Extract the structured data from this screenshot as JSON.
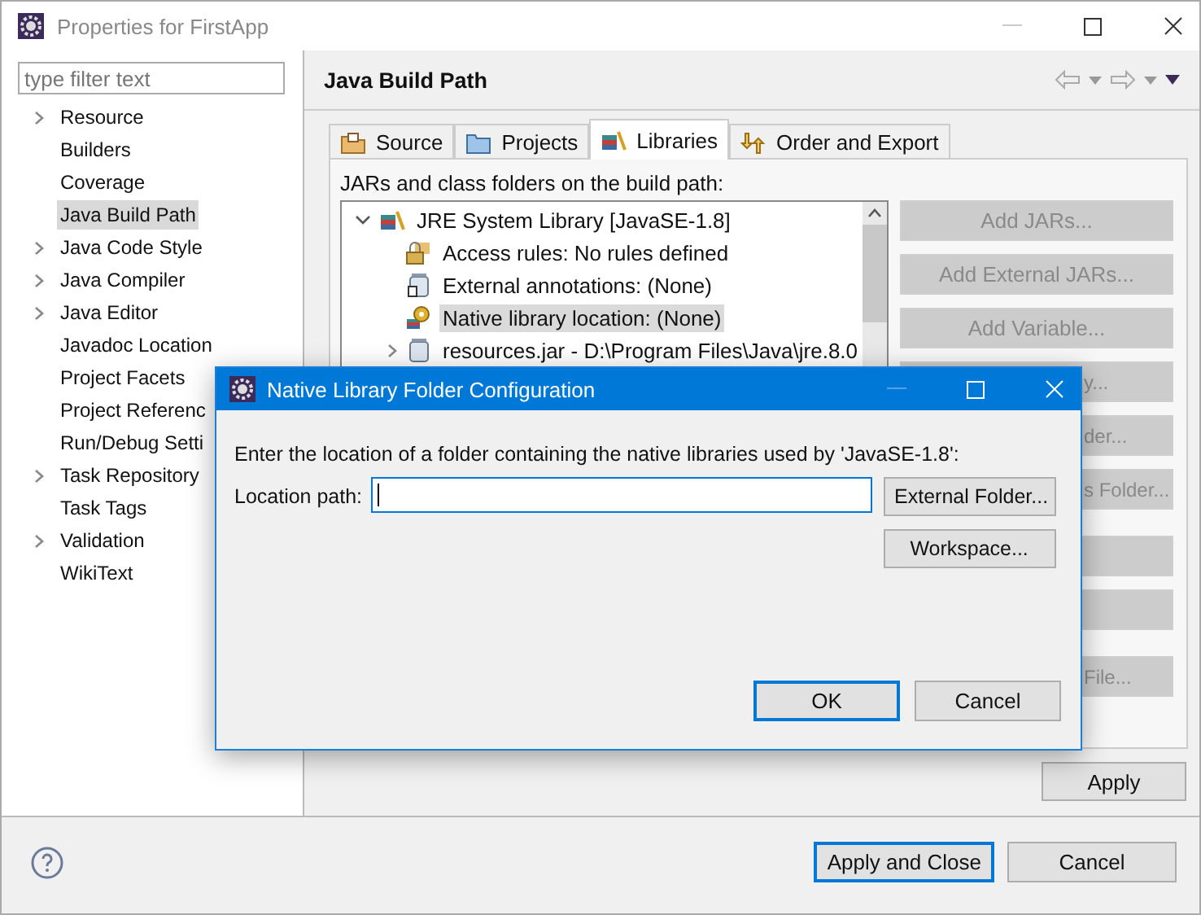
{
  "window": {
    "title": "Properties for FirstApp"
  },
  "filter": {
    "placeholder": "type filter text"
  },
  "nav": [
    {
      "label": "Resource",
      "expandable": true,
      "selected": false
    },
    {
      "label": "Builders",
      "expandable": false,
      "selected": false
    },
    {
      "label": "Coverage",
      "expandable": false,
      "selected": false
    },
    {
      "label": "Java Build Path",
      "expandable": false,
      "selected": true
    },
    {
      "label": "Java Code Style",
      "expandable": true,
      "selected": false
    },
    {
      "label": "Java Compiler",
      "expandable": true,
      "selected": false
    },
    {
      "label": "Java Editor",
      "expandable": true,
      "selected": false
    },
    {
      "label": "Javadoc Location",
      "expandable": false,
      "selected": false
    },
    {
      "label": "Project Facets",
      "expandable": false,
      "selected": false
    },
    {
      "label": "Project Referenc",
      "expandable": false,
      "selected": false
    },
    {
      "label": "Run/Debug Setti",
      "expandable": false,
      "selected": false
    },
    {
      "label": "Task Repository",
      "expandable": true,
      "selected": false
    },
    {
      "label": "Task Tags",
      "expandable": false,
      "selected": false
    },
    {
      "label": "Validation",
      "expandable": true,
      "selected": false
    },
    {
      "label": "WikiText",
      "expandable": false,
      "selected": false
    }
  ],
  "page": {
    "title": "Java Build Path"
  },
  "tabs": [
    {
      "label": "Source",
      "kind": "source",
      "selected": false
    },
    {
      "label": "Projects",
      "kind": "projects",
      "selected": false
    },
    {
      "label": "Libraries",
      "kind": "libraries",
      "selected": true
    },
    {
      "label": "Order and Export",
      "kind": "order",
      "selected": false
    }
  ],
  "build_path": {
    "label": "JARs and class folders on the build path:",
    "tree": [
      {
        "label": "JRE System Library [JavaSE-1.8]",
        "kind": "library",
        "expanded": true,
        "selected": false,
        "children": [
          {
            "label": "Access rules: No rules defined",
            "kind": "rules",
            "selected": false
          },
          {
            "label": "External annotations: (None)",
            "kind": "annotations",
            "selected": false
          },
          {
            "label": "Native library location: (None)",
            "kind": "native",
            "selected": true
          },
          {
            "label": "resources.jar - D:\\Program Files\\Java\\jre.8.0",
            "kind": "jar",
            "expanded": false,
            "selected": false
          }
        ]
      }
    ]
  },
  "side_button_groups": [
    [
      {
        "label": "Add JARs...",
        "disabled": true,
        "covered": false
      },
      {
        "label": "Add External JARs...",
        "disabled": true,
        "covered": false
      },
      {
        "label": "Add Variable...",
        "disabled": true,
        "covered": false
      },
      {
        "label": "y...",
        "disabled": true,
        "covered": true
      },
      {
        "label": "der...",
        "disabled": true,
        "covered": true
      },
      {
        "label": "s Folder...",
        "disabled": true,
        "covered": true
      }
    ],
    [
      {
        "disabled": true
      },
      {
        "disabled": true
      }
    ],
    [
      {
        "label": "File...",
        "disabled": true,
        "covered": true
      }
    ]
  ],
  "apply": "Apply",
  "footer_buttons": [
    {
      "label": "Apply and Close",
      "default": true
    },
    {
      "label": "Cancel",
      "default": false
    }
  ],
  "dialog": {
    "title": "Native Library Folder Configuration",
    "message": "Enter the location of a folder containing the native libraries used by 'JavaSE-1.8':",
    "field_label": "Location path:",
    "side_buttons": [
      "External Folder...",
      "Workspace..."
    ],
    "buttons": [
      {
        "label": "OK",
        "default": true
      },
      {
        "label": "Cancel",
        "default": false
      }
    ]
  }
}
